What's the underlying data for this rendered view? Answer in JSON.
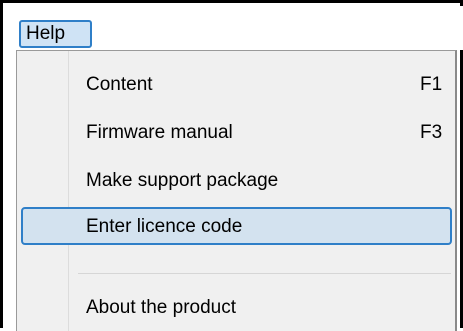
{
  "menubar": {
    "active_menu": "Help"
  },
  "help_menu": {
    "items": [
      {
        "label": "Content",
        "shortcut": "F1"
      },
      {
        "label": "Firmware manual",
        "shortcut": "F3"
      },
      {
        "label": "Make support package",
        "shortcut": ""
      },
      {
        "label": "Enter licence code",
        "shortcut": "",
        "highlighted": true
      },
      {
        "label": "About the product",
        "shortcut": ""
      }
    ]
  },
  "colors": {
    "highlight_border": "#2f7fc8",
    "highlight_fill": "#d3e2ef",
    "menu_background": "#f0f0f0"
  }
}
